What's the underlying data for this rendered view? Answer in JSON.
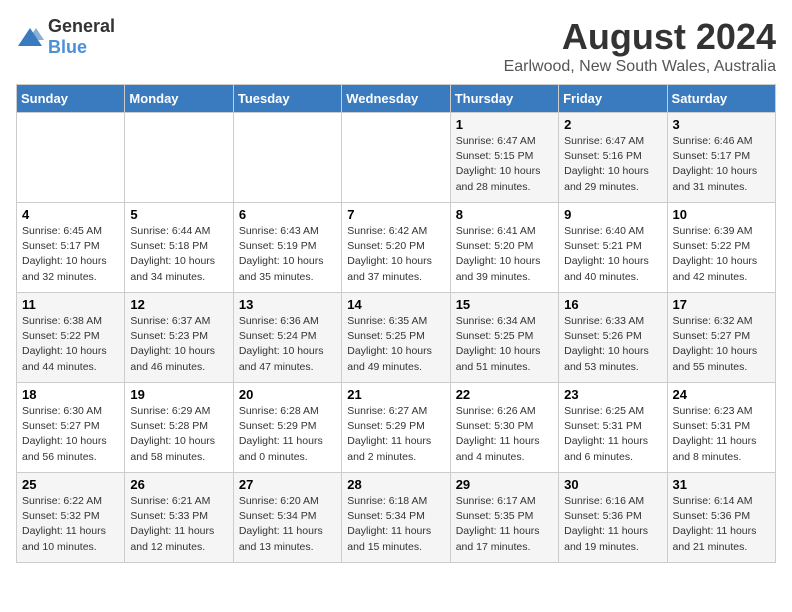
{
  "logo": {
    "text_general": "General",
    "text_blue": "Blue"
  },
  "title": "August 2024",
  "subtitle": "Earlwood, New South Wales, Australia",
  "days_of_week": [
    "Sunday",
    "Monday",
    "Tuesday",
    "Wednesday",
    "Thursday",
    "Friday",
    "Saturday"
  ],
  "weeks": [
    [
      {
        "day": "",
        "info": ""
      },
      {
        "day": "",
        "info": ""
      },
      {
        "day": "",
        "info": ""
      },
      {
        "day": "",
        "info": ""
      },
      {
        "day": "1",
        "info": "Sunrise: 6:47 AM\nSunset: 5:15 PM\nDaylight: 10 hours\nand 28 minutes."
      },
      {
        "day": "2",
        "info": "Sunrise: 6:47 AM\nSunset: 5:16 PM\nDaylight: 10 hours\nand 29 minutes."
      },
      {
        "day": "3",
        "info": "Sunrise: 6:46 AM\nSunset: 5:17 PM\nDaylight: 10 hours\nand 31 minutes."
      }
    ],
    [
      {
        "day": "4",
        "info": "Sunrise: 6:45 AM\nSunset: 5:17 PM\nDaylight: 10 hours\nand 32 minutes."
      },
      {
        "day": "5",
        "info": "Sunrise: 6:44 AM\nSunset: 5:18 PM\nDaylight: 10 hours\nand 34 minutes."
      },
      {
        "day": "6",
        "info": "Sunrise: 6:43 AM\nSunset: 5:19 PM\nDaylight: 10 hours\nand 35 minutes."
      },
      {
        "day": "7",
        "info": "Sunrise: 6:42 AM\nSunset: 5:20 PM\nDaylight: 10 hours\nand 37 minutes."
      },
      {
        "day": "8",
        "info": "Sunrise: 6:41 AM\nSunset: 5:20 PM\nDaylight: 10 hours\nand 39 minutes."
      },
      {
        "day": "9",
        "info": "Sunrise: 6:40 AM\nSunset: 5:21 PM\nDaylight: 10 hours\nand 40 minutes."
      },
      {
        "day": "10",
        "info": "Sunrise: 6:39 AM\nSunset: 5:22 PM\nDaylight: 10 hours\nand 42 minutes."
      }
    ],
    [
      {
        "day": "11",
        "info": "Sunrise: 6:38 AM\nSunset: 5:22 PM\nDaylight: 10 hours\nand 44 minutes."
      },
      {
        "day": "12",
        "info": "Sunrise: 6:37 AM\nSunset: 5:23 PM\nDaylight: 10 hours\nand 46 minutes."
      },
      {
        "day": "13",
        "info": "Sunrise: 6:36 AM\nSunset: 5:24 PM\nDaylight: 10 hours\nand 47 minutes."
      },
      {
        "day": "14",
        "info": "Sunrise: 6:35 AM\nSunset: 5:25 PM\nDaylight: 10 hours\nand 49 minutes."
      },
      {
        "day": "15",
        "info": "Sunrise: 6:34 AM\nSunset: 5:25 PM\nDaylight: 10 hours\nand 51 minutes."
      },
      {
        "day": "16",
        "info": "Sunrise: 6:33 AM\nSunset: 5:26 PM\nDaylight: 10 hours\nand 53 minutes."
      },
      {
        "day": "17",
        "info": "Sunrise: 6:32 AM\nSunset: 5:27 PM\nDaylight: 10 hours\nand 55 minutes."
      }
    ],
    [
      {
        "day": "18",
        "info": "Sunrise: 6:30 AM\nSunset: 5:27 PM\nDaylight: 10 hours\nand 56 minutes."
      },
      {
        "day": "19",
        "info": "Sunrise: 6:29 AM\nSunset: 5:28 PM\nDaylight: 10 hours\nand 58 minutes."
      },
      {
        "day": "20",
        "info": "Sunrise: 6:28 AM\nSunset: 5:29 PM\nDaylight: 11 hours\nand 0 minutes."
      },
      {
        "day": "21",
        "info": "Sunrise: 6:27 AM\nSunset: 5:29 PM\nDaylight: 11 hours\nand 2 minutes."
      },
      {
        "day": "22",
        "info": "Sunrise: 6:26 AM\nSunset: 5:30 PM\nDaylight: 11 hours\nand 4 minutes."
      },
      {
        "day": "23",
        "info": "Sunrise: 6:25 AM\nSunset: 5:31 PM\nDaylight: 11 hours\nand 6 minutes."
      },
      {
        "day": "24",
        "info": "Sunrise: 6:23 AM\nSunset: 5:31 PM\nDaylight: 11 hours\nand 8 minutes."
      }
    ],
    [
      {
        "day": "25",
        "info": "Sunrise: 6:22 AM\nSunset: 5:32 PM\nDaylight: 11 hours\nand 10 minutes."
      },
      {
        "day": "26",
        "info": "Sunrise: 6:21 AM\nSunset: 5:33 PM\nDaylight: 11 hours\nand 12 minutes."
      },
      {
        "day": "27",
        "info": "Sunrise: 6:20 AM\nSunset: 5:34 PM\nDaylight: 11 hours\nand 13 minutes."
      },
      {
        "day": "28",
        "info": "Sunrise: 6:18 AM\nSunset: 5:34 PM\nDaylight: 11 hours\nand 15 minutes."
      },
      {
        "day": "29",
        "info": "Sunrise: 6:17 AM\nSunset: 5:35 PM\nDaylight: 11 hours\nand 17 minutes."
      },
      {
        "day": "30",
        "info": "Sunrise: 6:16 AM\nSunset: 5:36 PM\nDaylight: 11 hours\nand 19 minutes."
      },
      {
        "day": "31",
        "info": "Sunrise: 6:14 AM\nSunset: 5:36 PM\nDaylight: 11 hours\nand 21 minutes."
      }
    ]
  ]
}
